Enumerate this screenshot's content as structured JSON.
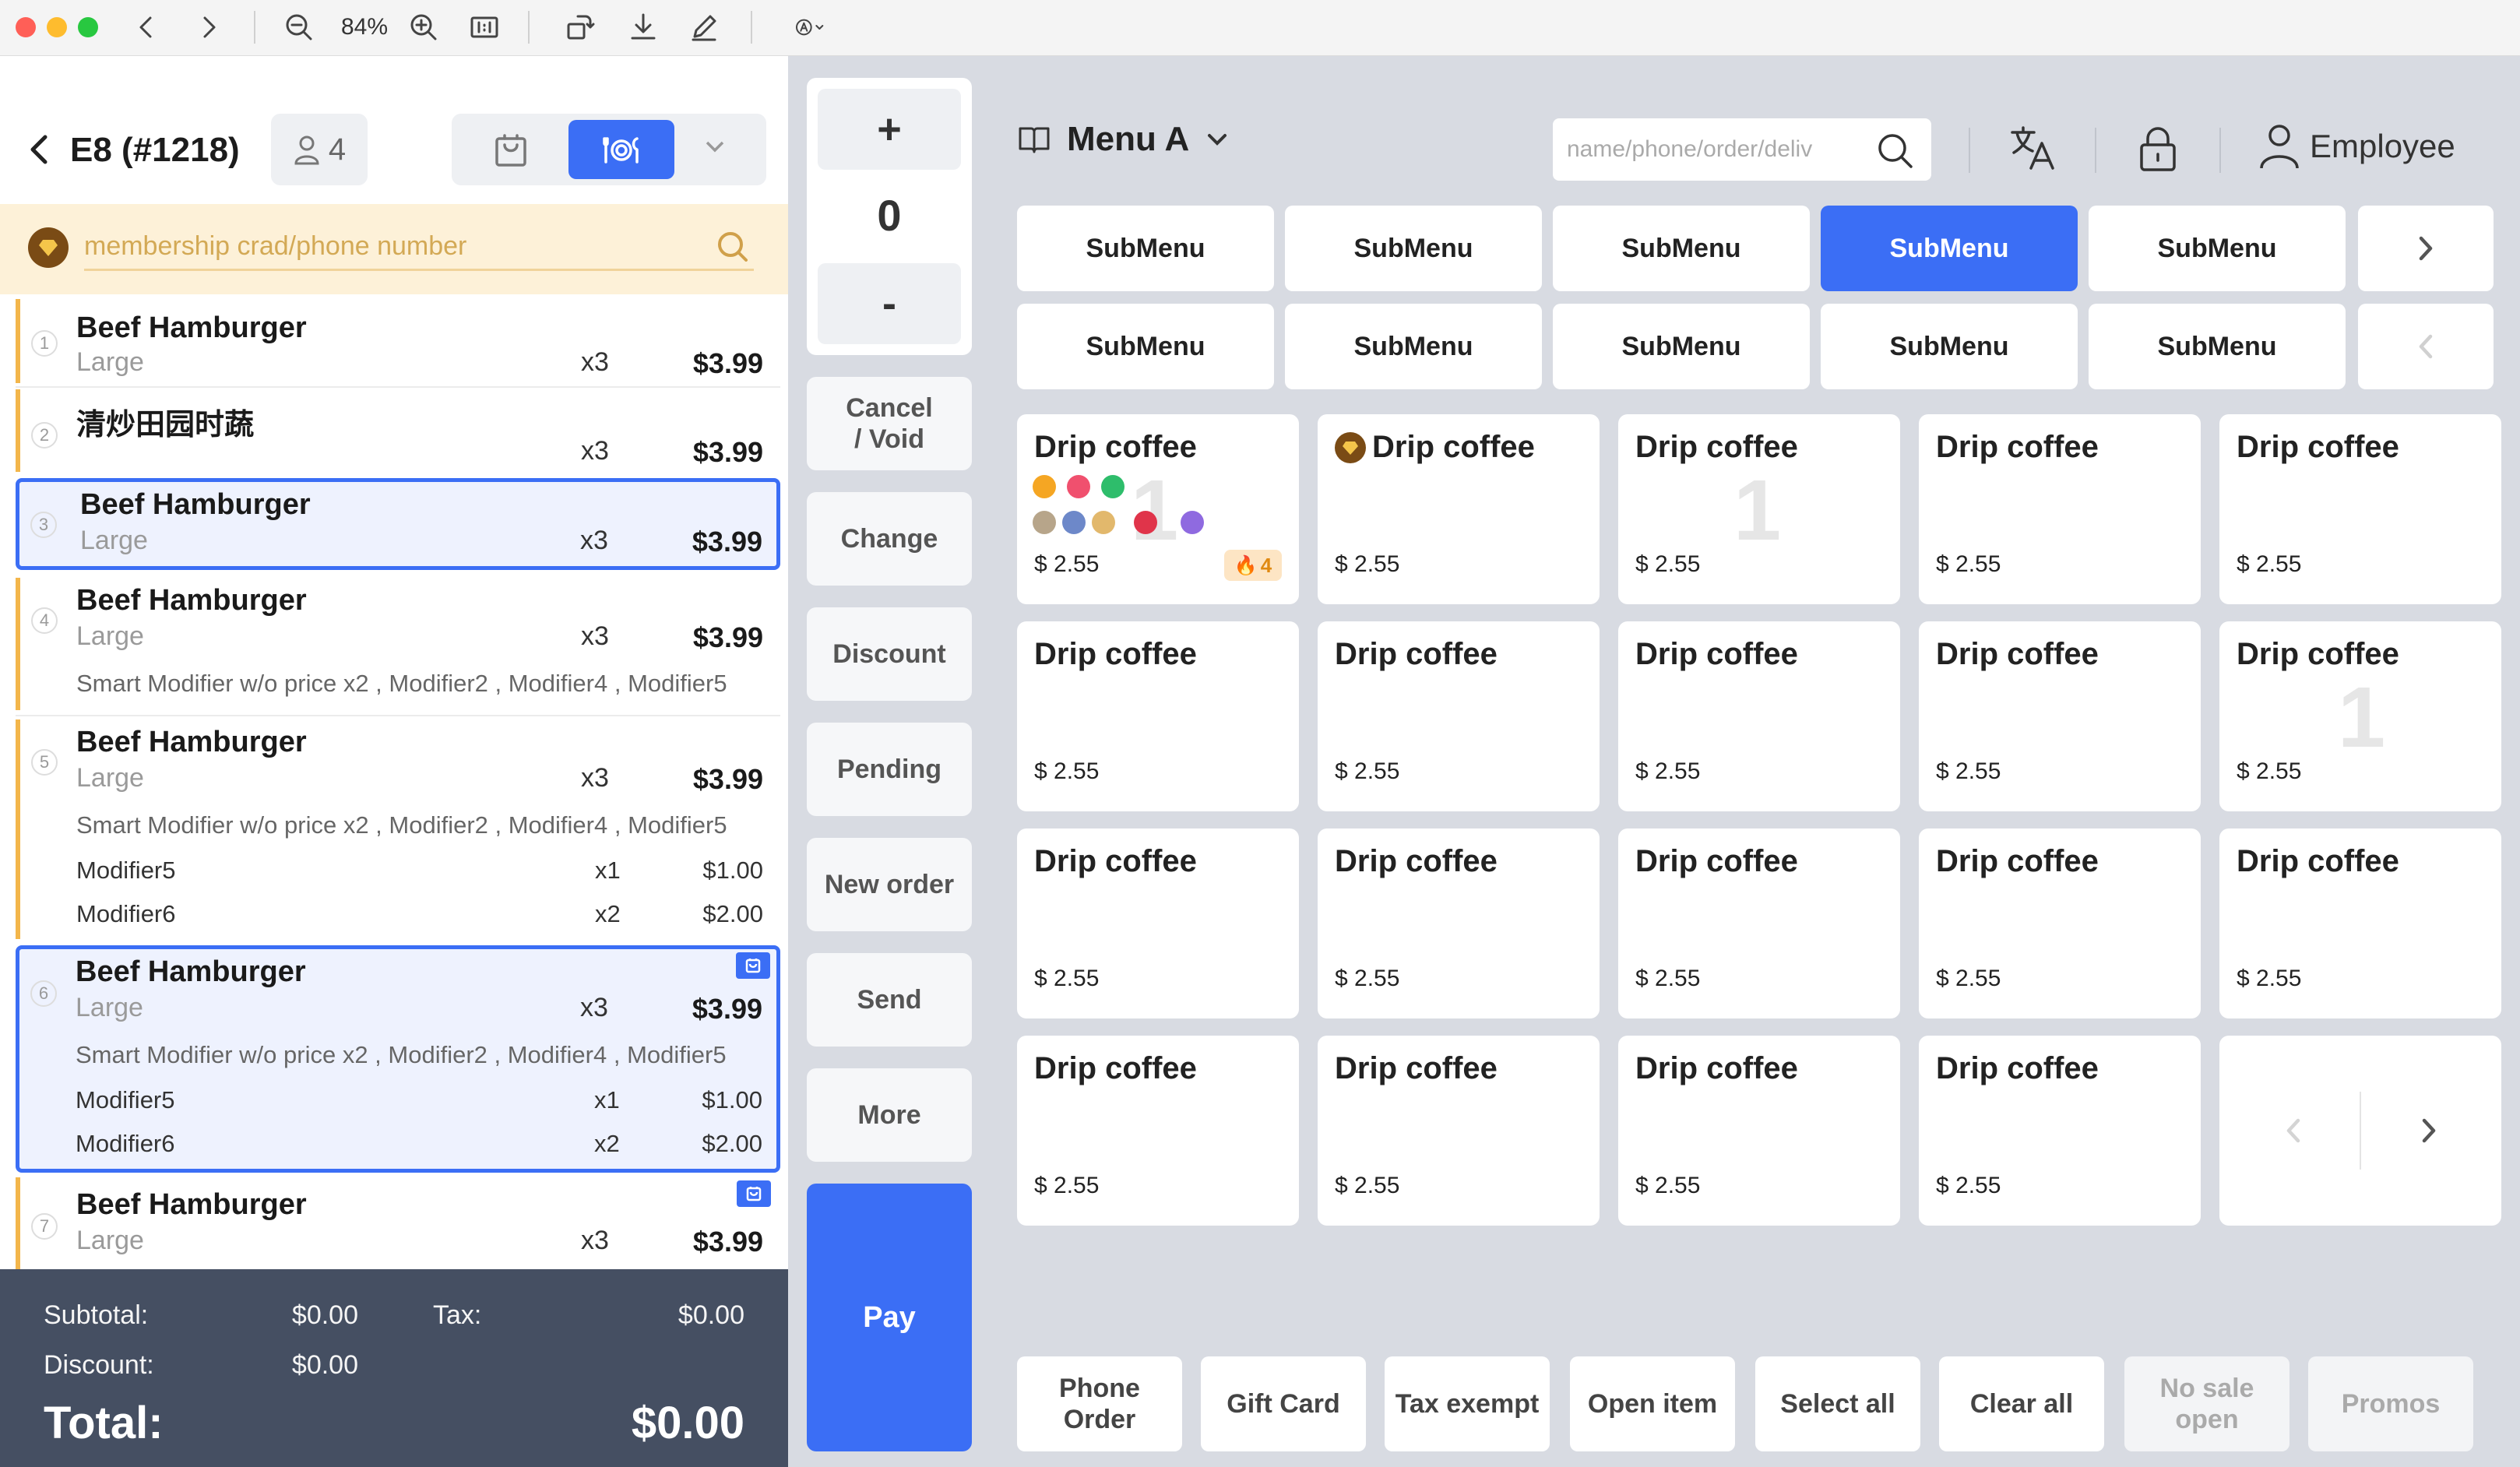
{
  "viewer": {
    "zoom_label": "84%"
  },
  "order": {
    "table_title": "E8 (#1218)",
    "guest_count": "4",
    "member_placeholder": "membership crad/phone number",
    "items": [
      {
        "index": "1",
        "name": "Beef Hamburger",
        "size": "Large",
        "qty": "x3",
        "price": "$3.99"
      },
      {
        "index": "2",
        "name": "清炒田园时蔬",
        "size": "",
        "qty": "x3",
        "price": "$3.99"
      },
      {
        "index": "3",
        "name": "Beef Hamburger",
        "size": "Large",
        "qty": "x3",
        "price": "$3.99"
      },
      {
        "index": "4",
        "name": "Beef Hamburger",
        "size": "Large",
        "qty": "x3",
        "price": "$3.99",
        "mods": "Smart Modifier w/o price x2 , Modifier2 , Modifier4 , Modifier5"
      },
      {
        "index": "5",
        "name": "Beef Hamburger",
        "size": "Large",
        "qty": "x3",
        "price": "$3.99",
        "mods": "Smart Modifier w/o price x2 , Modifier2 , Modifier4 , Modifier5",
        "extra": [
          {
            "name": "Modifier5",
            "qty": "x1",
            "price": "$1.00"
          },
          {
            "name": "Modifier6",
            "qty": "x2",
            "price": "$2.00"
          }
        ]
      },
      {
        "index": "6",
        "name": "Beef Hamburger",
        "size": "Large",
        "qty": "x3",
        "price": "$3.99",
        "mods": "Smart Modifier w/o price x2 , Modifier2 , Modifier4 , Modifier5",
        "extra": [
          {
            "name": "Modifier5",
            "qty": "x1",
            "price": "$1.00"
          },
          {
            "name": "Modifier6",
            "qty": "x2",
            "price": "$2.00"
          }
        ]
      },
      {
        "index": "7",
        "name": "Beef Hamburger",
        "size": "Large",
        "qty": "x3",
        "price": "$3.99"
      }
    ],
    "totals": {
      "subtotal_label": "Subtotal:",
      "subtotal": "$0.00",
      "tax_label": "Tax:",
      "tax": "$0.00",
      "discount_label": "Discount:",
      "discount": "$0.00",
      "total_label": "Total:",
      "total": "$0.00"
    }
  },
  "actions": {
    "plus": "+",
    "qty": "0",
    "minus": "-",
    "cancel_void_line1": "Cancel",
    "cancel_void_line2": "/ Void",
    "change": "Change",
    "discount": "Discount",
    "pending": "Pending",
    "new_order": "New order",
    "send": "Send",
    "more": "More",
    "pay": "Pay"
  },
  "menu": {
    "title": "Menu A",
    "search_placeholder": "name/phone/order/deliv",
    "employee_label": "Employee",
    "submenus_row1": [
      "SubMenu",
      "SubMenu",
      "SubMenu",
      "SubMenu",
      "SubMenu"
    ],
    "submenus_row2": [
      "SubMenu",
      "SubMenu",
      "SubMenu",
      "SubMenu",
      "SubMenu"
    ],
    "active_submenu_index": 3,
    "items": [
      {
        "name": "Drip coffee",
        "price": "$ 2.55"
      },
      {
        "name": "Drip coffee",
        "price": "$ 2.55"
      },
      {
        "name": "Drip coffee",
        "price": "$ 2.55"
      },
      {
        "name": "Drip coffee",
        "price": "$ 2.55"
      },
      {
        "name": "Drip coffee",
        "price": "$ 2.55"
      },
      {
        "name": "Drip coffee",
        "price": "$ 2.55"
      },
      {
        "name": "Drip coffee",
        "price": "$ 2.55"
      },
      {
        "name": "Drip coffee",
        "price": "$ 2.55"
      },
      {
        "name": "Drip coffee",
        "price": "$ 2.55"
      },
      {
        "name": "Drip coffee",
        "price": "$ 2.55"
      },
      {
        "name": "Drip coffee",
        "price": "$ 2.55"
      },
      {
        "name": "Drip coffee",
        "price": "$ 2.55"
      },
      {
        "name": "Drip coffee",
        "price": "$ 2.55"
      },
      {
        "name": "Drip coffee",
        "price": "$ 2.55"
      },
      {
        "name": "Drip coffee",
        "price": "$ 2.55"
      },
      {
        "name": "Drip coffee",
        "price": "$ 2.55"
      },
      {
        "name": "Drip coffee",
        "price": "$ 2.55"
      },
      {
        "name": "Drip coffee",
        "price": "$ 2.55"
      },
      {
        "name": "Drip coffee",
        "price": "$ 2.55"
      }
    ],
    "stock_badge": "4",
    "ghost_count": "1",
    "bottom_buttons": {
      "phone_order_line1": "Phone",
      "phone_order_line2": "Order",
      "gift_card": "Gift Card",
      "tax_exempt": "Tax exempt",
      "open_item": "Open item",
      "select_all": "Select all",
      "clear_all": "Clear all",
      "no_sale_line1": "No sale",
      "no_sale_line2": "open",
      "promos": "Promos"
    }
  },
  "colors": {
    "accent": "#3b6ef5",
    "member_bg": "#fdf1d8",
    "totals_bg": "#454f62",
    "order_stripe": "#f3b64b"
  }
}
